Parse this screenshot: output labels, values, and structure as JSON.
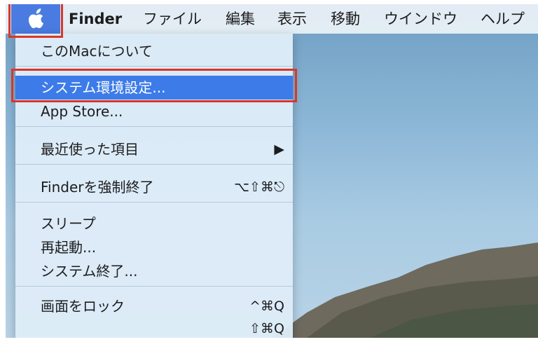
{
  "menubar": {
    "apple_icon": "apple-logo-icon",
    "items": [
      {
        "label": "Finder"
      },
      {
        "label": "ファイル"
      },
      {
        "label": "編集"
      },
      {
        "label": "表示"
      },
      {
        "label": "移動"
      },
      {
        "label": "ウインドウ"
      },
      {
        "label": "ヘルプ"
      }
    ]
  },
  "apple_menu": {
    "items": [
      {
        "label": "このMacについて",
        "shortcut": ""
      },
      {
        "label": "システム環境設定...",
        "shortcut": "",
        "highlighted": true
      },
      {
        "label": "App Store...",
        "shortcut": ""
      },
      {
        "label": "最近使った項目",
        "shortcut": "▶",
        "submenu": true
      },
      {
        "label": "Finderを強制終了",
        "shortcut": "⌥⇧⌘⎋"
      },
      {
        "label": "スリープ",
        "shortcut": ""
      },
      {
        "label": "再起動...",
        "shortcut": ""
      },
      {
        "label": "システム終了...",
        "shortcut": ""
      },
      {
        "label": "画面をロック",
        "shortcut": "^⌘Q"
      },
      {
        "label": "",
        "shortcut": "⇧⌘Q"
      }
    ]
  },
  "colors": {
    "highlight": "#3d7be8",
    "annotation_box": "#d9372a"
  }
}
